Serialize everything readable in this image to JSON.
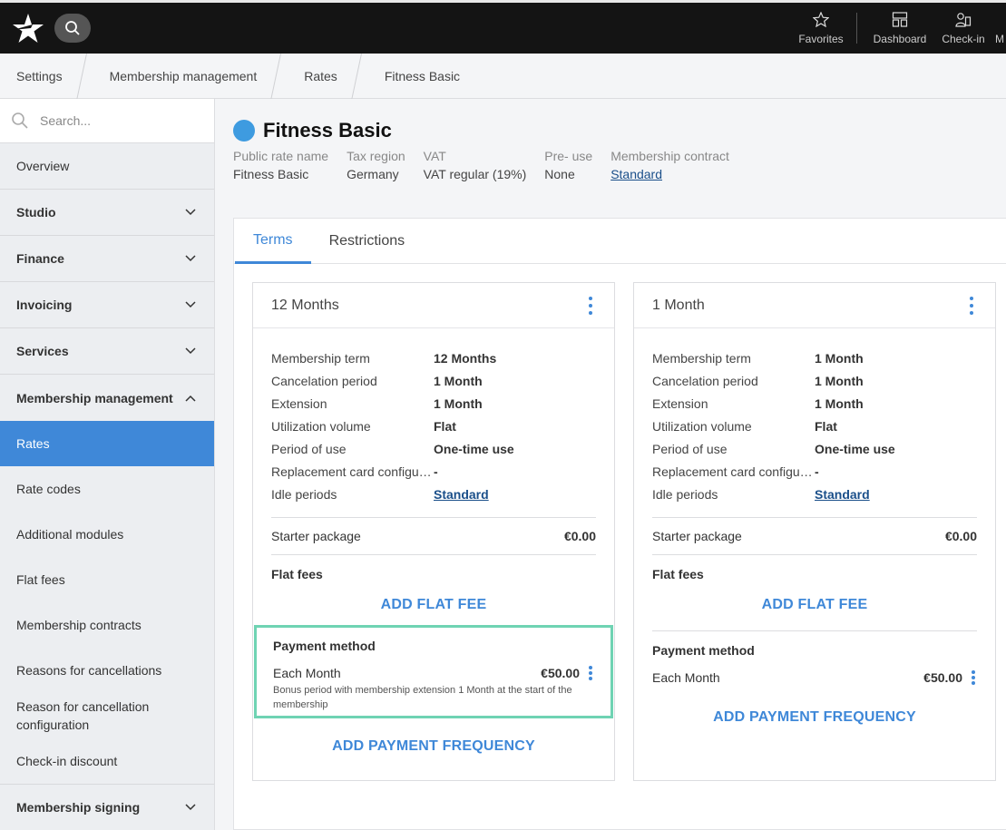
{
  "topbar": {
    "actions": [
      {
        "label": "Favorites",
        "icon": "star-icon"
      },
      {
        "label": "Dashboard",
        "icon": "dashboard-icon"
      },
      {
        "label": "Check-in",
        "icon": "check-in-icon"
      }
    ],
    "cut_label": "M"
  },
  "breadcrumb": [
    "Settings",
    "Membership management",
    "Rates",
    "Fitness Basic"
  ],
  "sidebar": {
    "search_placeholder": "Search...",
    "overview": "Overview",
    "sections": [
      "Studio",
      "Finance",
      "Invoicing",
      "Services"
    ],
    "expanded": "Membership management",
    "sub_items": [
      "Rates",
      "Rate codes",
      "Additional modules",
      "Flat fees",
      "Membership contracts",
      "Reasons for cancellations",
      "Reason for cancellation configuration",
      "Check-in discount"
    ],
    "active_sub": "Rates",
    "last_section": "Membership signing"
  },
  "rate": {
    "title": "Fitness Basic",
    "dot_color": "#3e9be0",
    "meta": [
      {
        "label": "Public rate name",
        "value": "Fitness Basic"
      },
      {
        "label": "Tax region",
        "value": "Germany"
      },
      {
        "label": "VAT",
        "value": "VAT regular (19%)"
      },
      {
        "label": "Pre- use",
        "value": "None"
      },
      {
        "label": "Membership contract",
        "value": "Standard"
      }
    ]
  },
  "tabs": [
    "Terms",
    "Restrictions"
  ],
  "active_tab": "Terms",
  "terms": [
    {
      "title": "12 Months",
      "rows": [
        {
          "k": "Membership term",
          "v": "12 Months"
        },
        {
          "k": "Cancelation period",
          "v": "1 Month"
        },
        {
          "k": "Extension",
          "v": "1 Month"
        },
        {
          "k": "Utilization volume",
          "v": "Flat"
        },
        {
          "k": "Period of use",
          "v": "One-time use"
        },
        {
          "k": "Replacement card configuration",
          "v": "-"
        },
        {
          "k": "Idle periods",
          "v": "Standard"
        }
      ],
      "starter_label": "Starter package",
      "starter_price": "€0.00",
      "flat_fees_label": "Flat fees",
      "add_flat_fee": "ADD FLAT FEE",
      "payment_label": "Payment method",
      "payment_freq": "Each Month",
      "payment_price": "€50.00",
      "bonus": "Bonus period with membership extension 1 Month at the start of the membership",
      "add_payment": "ADD PAYMENT FREQUENCY"
    },
    {
      "title": "1 Month",
      "rows": [
        {
          "k": "Membership term",
          "v": "1 Month"
        },
        {
          "k": "Cancelation period",
          "v": "1 Month"
        },
        {
          "k": "Extension",
          "v": "1 Month"
        },
        {
          "k": "Utilization volume",
          "v": "Flat"
        },
        {
          "k": "Period of use",
          "v": "One-time use"
        },
        {
          "k": "Replacement card configuration",
          "v": "-"
        },
        {
          "k": "Idle periods",
          "v": "Standard"
        }
      ],
      "starter_label": "Starter package",
      "starter_price": "€0.00",
      "flat_fees_label": "Flat fees",
      "add_flat_fee": "ADD FLAT FEE",
      "payment_label": "Payment method",
      "payment_freq": "Each Month",
      "payment_price": "€50.00",
      "add_payment": "ADD PAYMENT FREQUENCY"
    }
  ],
  "colors": {
    "accent": "#3f88d8",
    "highlight": "#6fd3b3",
    "topbar": "#141414"
  }
}
